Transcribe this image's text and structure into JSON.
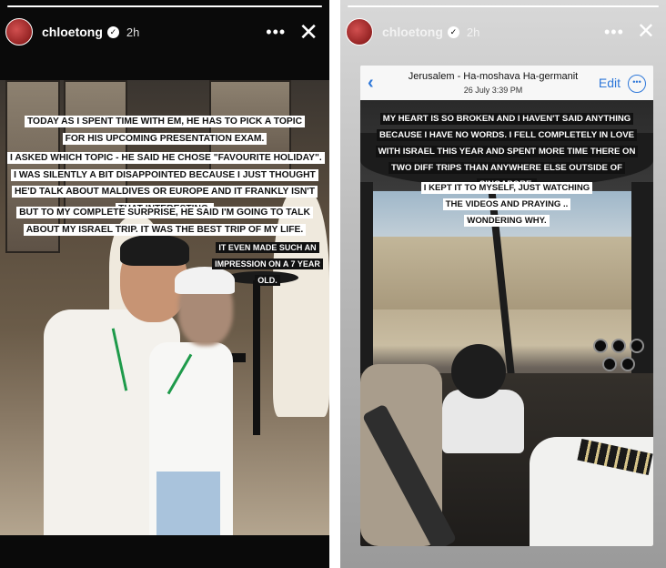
{
  "left_story": {
    "progress": 1.0,
    "username": "chloetong",
    "verified_icon": "verified-badge-icon",
    "time": "2h",
    "more_icon": "more-horizontal-icon",
    "close_icon": "close-icon",
    "captions": [
      "TODAY AS I SPENT TIME WITH EM, HE HAS TO PICK A TOPIC FOR HIS UPCOMING PRESENTATION EXAM.",
      "I ASKED WHICH TOPIC - HE SAID HE CHOSE \"FAVOURITE HOLIDAY\". I WAS SILENTLY A BIT DISAPPOINTED BECAUSE I JUST THOUGHT HE'D TALK ABOUT MALDIVES OR EUROPE AND IT FRANKLY ISN'T THAT INTERESTING.",
      "BUT TO MY COMPLETE SURPRISE, HE SAID I'M GOING TO TALK ABOUT MY ISRAEL TRIP. IT WAS THE BEST TRIP OF MY LIFE.",
      "IT EVEN MADE SUCH AN IMPRESSION ON A 7 YEAR OLD."
    ]
  },
  "right_story": {
    "progress": 1.0,
    "username": "chloetong",
    "verified_icon": "verified-badge-icon",
    "time": "2h",
    "more_icon": "more-horizontal-icon",
    "close_icon": "close-icon",
    "photo_header": {
      "back_icon": "chevron-left-icon",
      "location": "Jerusalem - Ha-moshava Ha-germanit",
      "date": "26 July  3:39 PM",
      "edit_label": "Edit",
      "more_icon": "ellipsis-circle-icon"
    },
    "captions": [
      "MY HEART IS SO BROKEN AND I HAVEN'T SAID ANYTHING BECAUSE I HAVE NO WORDS. I FELL COMPLETELY IN LOVE WITH ISRAEL THIS YEAR AND SPENT MORE TIME THERE ON TWO DIFF TRIPS THAN ANYWHERE ELSE OUTSIDE OF SINGAPORE.",
      "I KEPT IT TO MYSELF, JUST WATCHING THE VIDEOS AND PRAYING .. WONDERING WHY."
    ]
  }
}
